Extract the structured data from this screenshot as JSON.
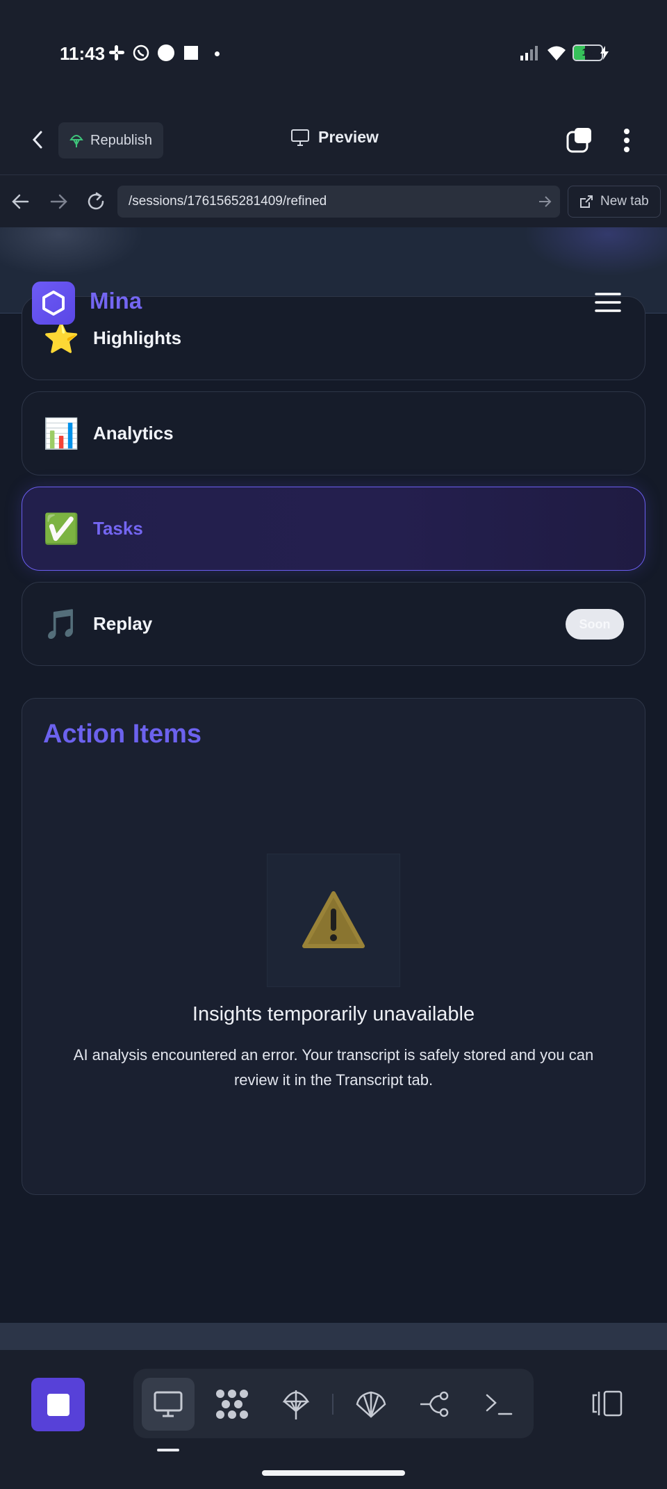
{
  "status_bar": {
    "time": "11:43",
    "battery": "15",
    "icons": [
      "slack-icon",
      "whatsapp-icon",
      "circle-icon",
      "square-icon",
      "dot-icon",
      "signal-icon",
      "wifi-icon",
      "battery-icon"
    ]
  },
  "header": {
    "republish_label": "Republish",
    "preview_label": "Preview"
  },
  "url_bar": {
    "url": "/sessions/1761565281409/refined",
    "new_tab_label": "New tab"
  },
  "app": {
    "brand": "Mina"
  },
  "nav_cards": [
    {
      "emoji": "⭐",
      "label": "Highlights",
      "active": false
    },
    {
      "emoji": "📊",
      "label": "Analytics",
      "active": false
    },
    {
      "emoji": "✅",
      "label": "Tasks",
      "active": true
    },
    {
      "emoji": "🎵",
      "label": "Replay",
      "active": false,
      "badge": "Soon"
    }
  ],
  "action_items": {
    "title": "Action Items",
    "warning_emoji": "⚠️",
    "error_title": "Insights temporarily unavailable",
    "error_body": "AI analysis encountered an error. Your transcript is safely stored and you can review it in the Transcript tab."
  },
  "dock": {
    "tools": [
      "desktop-icon",
      "pattern-icon",
      "parachute-icon",
      "shell-icon",
      "git-branch-icon",
      "terminal-icon"
    ],
    "selected_tool": "desktop-icon"
  },
  "colors": {
    "accent": "#6c62ee",
    "background": "#141a28",
    "stop_button": "#5741d8"
  }
}
